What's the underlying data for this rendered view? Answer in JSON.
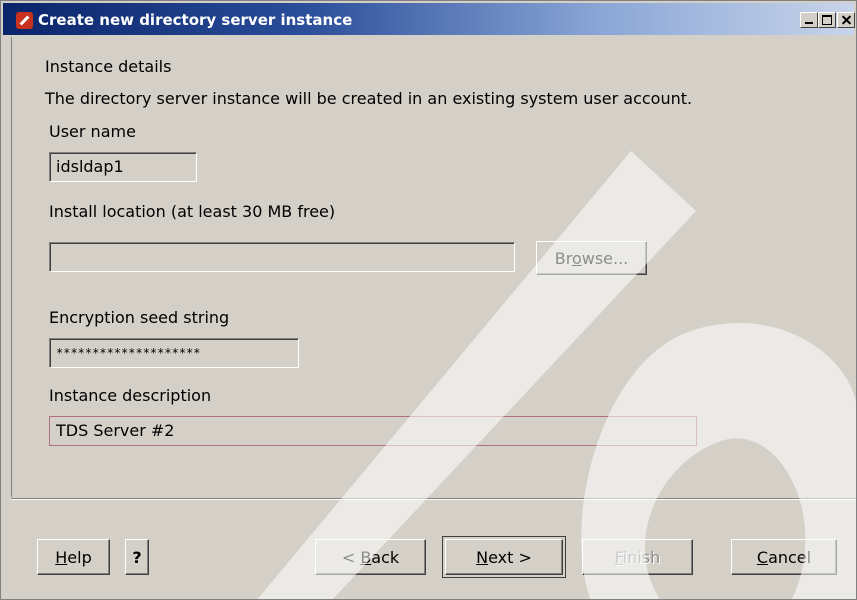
{
  "window": {
    "title": "Create new directory server instance"
  },
  "section": {
    "heading": "Instance details",
    "description": "The directory server instance will be created in an existing system user account."
  },
  "fields": {
    "user_name_label": "User name",
    "user_name_value": "idsldap1",
    "install_location_label": "Install location (at least 30 MB free)",
    "install_location_value": "",
    "browse_label": "Browse...",
    "encryption_label": "Encryption seed string",
    "encryption_value": "********************",
    "description_label": "Instance description",
    "description_value": "TDS Server #2"
  },
  "buttons": {
    "help": "Help",
    "help_mnemonic": "H",
    "question": "?",
    "back": "< Back",
    "back_mnemonic": "B",
    "next": "Next >",
    "next_mnemonic": "N",
    "finish": "Finish",
    "finish_mnemonic": "F",
    "cancel": "Cancel",
    "cancel_mnemonic": "C"
  },
  "icons": {
    "app_icon": "pencil-icon",
    "minimize": "minimize-icon",
    "maximize": "maximize-icon",
    "close": "close-icon"
  },
  "colors": {
    "title_bar": "#0a246a",
    "window_bg": "#d4d0c8",
    "active_field_border": "#b07080"
  }
}
